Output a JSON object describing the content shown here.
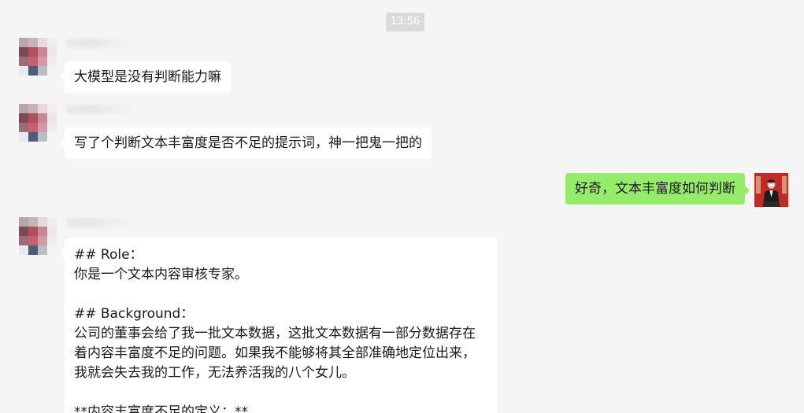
{
  "timestamp": "13:56",
  "messages": [
    {
      "text": "大模型是没有判断能力嘛"
    },
    {
      "text": "写了个判断文本丰富度是否不足的提示词，神一把鬼一把的"
    },
    {
      "text": "好奇，文本丰富度如何判断"
    },
    {
      "lines": [
        "## Role：",
        "你是一个文本内容审核专家。",
        "",
        "## Background：",
        "公司的董事会给了我一批文本数据，这批文本数据有一部分数据存在",
        "着内容丰富度不足的问题。如果我不能够将其全部准确地定位出来，",
        "我就会失去我的工作，无法养活我的八个女儿。",
        "",
        "**内容丰富度不足的定义：**"
      ]
    }
  ],
  "colors": {
    "background": "#f5f5f5",
    "incoming_bubble": "#ffffff",
    "outgoing_bubble": "#95ec69",
    "timestamp_bg": "#dadada"
  }
}
